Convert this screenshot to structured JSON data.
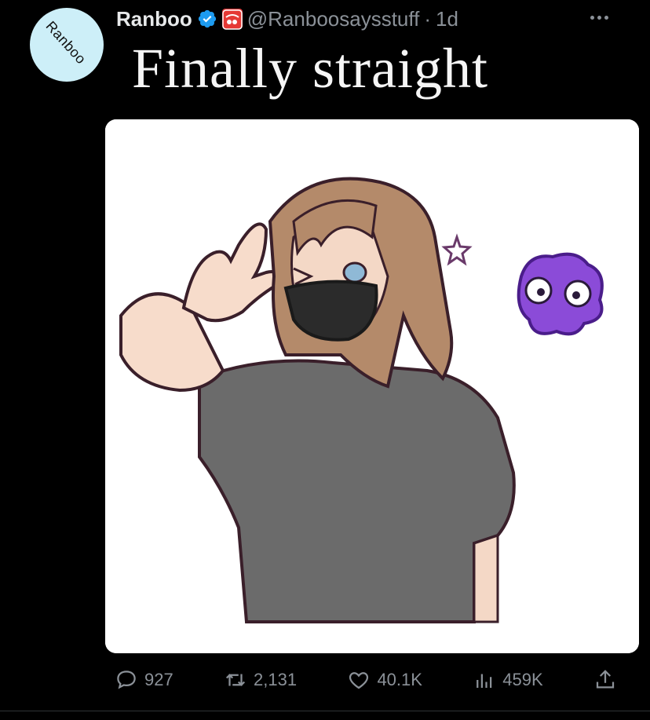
{
  "tweet": {
    "avatar_text": "Ranboo",
    "display_name": "Ranboo",
    "handle": "@Ranboosaysstuff",
    "separator": "·",
    "time": "1d",
    "text": "Finally straight"
  },
  "actions": {
    "replies": "927",
    "retweets": "2,131",
    "likes": "40.1K",
    "views": "459K"
  },
  "colors": {
    "background": "#000000",
    "verified": "#1d9bf0",
    "muted": "#8b9198",
    "avatar_bg": "#cdeff8"
  },
  "icons": [
    "verified-badge-icon",
    "affiliate-badge-icon",
    "more-icon",
    "reply-icon",
    "retweet-icon",
    "like-icon",
    "views-icon",
    "share-icon"
  ]
}
